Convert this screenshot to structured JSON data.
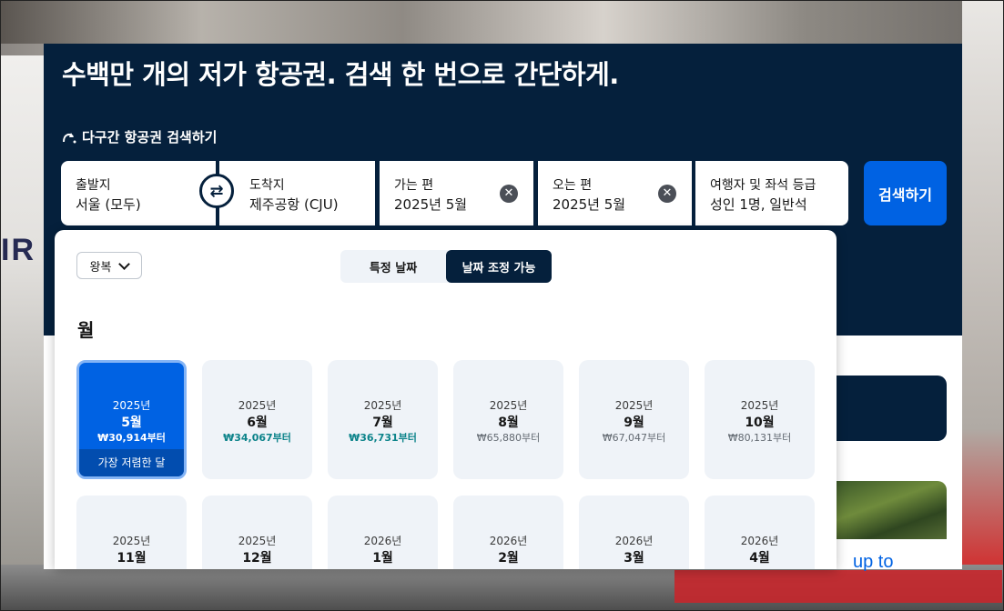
{
  "headline": "수백만 개의 저가 항공권. 검색 한 번으로 간단하게.",
  "multicity_label": "다구간 항공권 검색하기",
  "search": {
    "origin_label": "출발지",
    "origin_value": "서울 (모두)",
    "destination_label": "도착지",
    "destination_value": "제주공항 (CJU)",
    "depart_label": "가는 편",
    "depart_value": "2025년 5월",
    "return_label": "오는 편",
    "return_value": "2025년 5월",
    "travellers_label": "여행자 및 좌석 등급",
    "travellers_value": "성인 1명, 일반석",
    "search_button": "검색하기",
    "swap_icon": "⇄",
    "clear_icon": "✕"
  },
  "popup": {
    "trip_type": "왕복",
    "toggle": [
      "특정 날짜",
      "날짜 조정 가능"
    ],
    "active_toggle": 1,
    "section_title": "월",
    "months": [
      {
        "year": "2025년",
        "month": "5월",
        "price": "₩30,914부터",
        "badge": "가장 저렴한 달",
        "selected": true
      },
      {
        "year": "2025년",
        "month": "6월",
        "price": "₩34,067부터",
        "highlight": true
      },
      {
        "year": "2025년",
        "month": "7월",
        "price": "₩36,731부터",
        "highlight": true
      },
      {
        "year": "2025년",
        "month": "8월",
        "price": "₩65,880부터"
      },
      {
        "year": "2025년",
        "month": "9월",
        "price": "₩67,047부터"
      },
      {
        "year": "2025년",
        "month": "10월",
        "price": "₩80,131부터"
      },
      {
        "year": "2025년",
        "month": "11월",
        "price": ""
      },
      {
        "year": "2025년",
        "month": "12월",
        "price": ""
      },
      {
        "year": "2026년",
        "month": "1월",
        "price": ""
      },
      {
        "year": "2026년",
        "month": "2월",
        "price": ""
      },
      {
        "year": "2026년",
        "month": "3월",
        "price": ""
      },
      {
        "year": "2026년",
        "month": "4월",
        "price": ""
      }
    ]
  },
  "side_link": "up to",
  "colors": {
    "navy": "#05203c",
    "blue": "#0062e3",
    "green_price": "#0c838a"
  }
}
